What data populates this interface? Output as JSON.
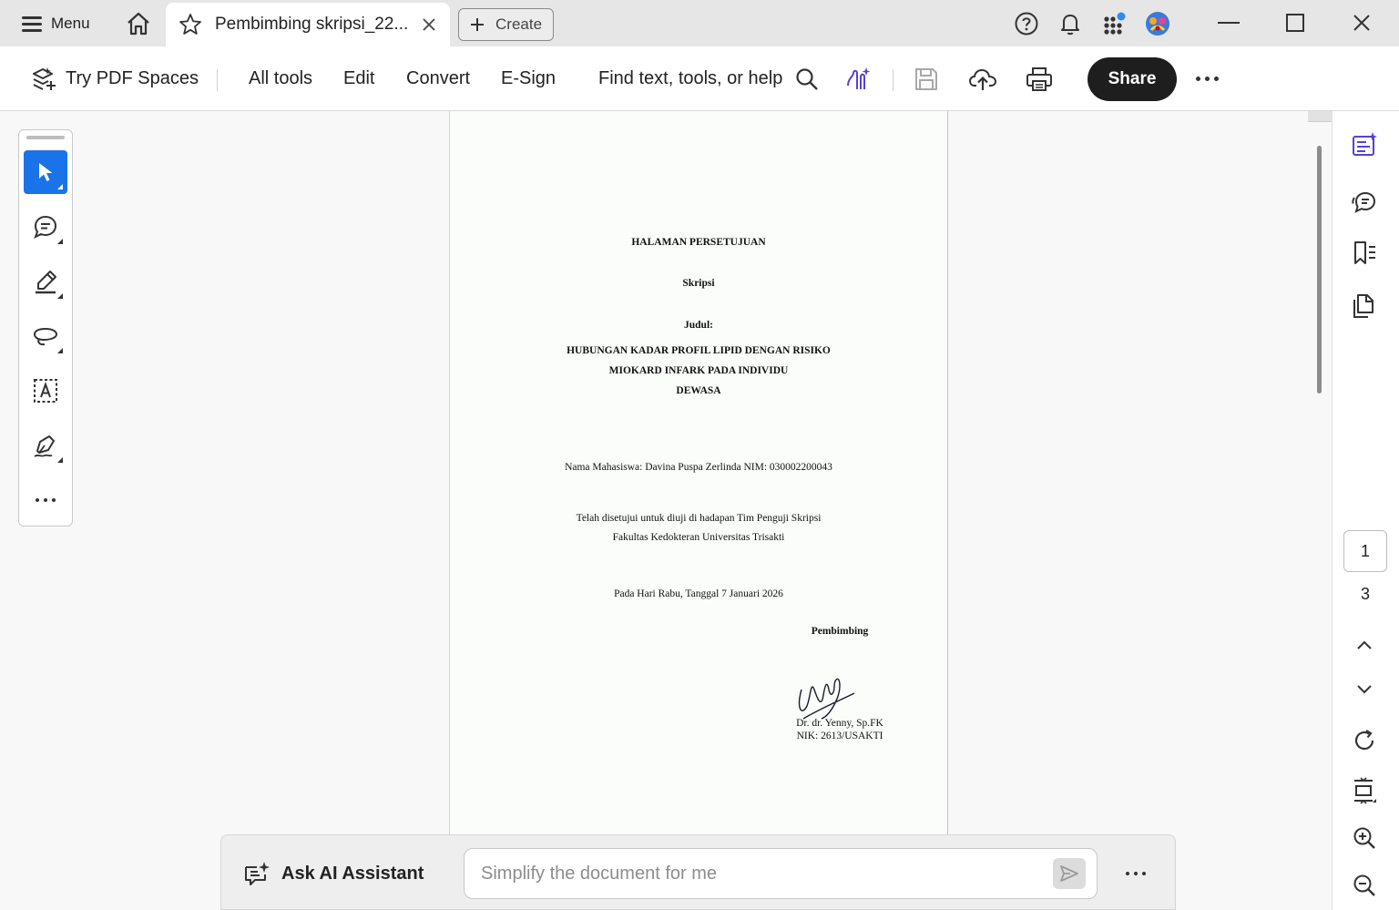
{
  "titlebar": {
    "menu_label": "Menu",
    "tab_title": "Pembimbing skripsi_22...",
    "create_label": "Create"
  },
  "toolbar": {
    "try_spaces": "Try PDF Spaces",
    "all_tools": "All tools",
    "edit": "Edit",
    "convert": "Convert",
    "esign": "E-Sign",
    "search_label": "Find text, tools, or help",
    "share": "Share"
  },
  "document": {
    "lines": [
      "HALAMAN PERSETUJUAN",
      "Skripsi",
      "Judul:",
      "HUBUNGAN KADAR PROFIL LIPID DENGAN RISIKO",
      "MIOKARD  INFARK PADA INDIVIDU",
      "DEWASA",
      "Nama Mahasiswa: Davina Puspa Zerlinda NIM: 030002200043",
      "Telah disetujui untuk diuji di hadapan Tim Penguji Skripsi",
      "Fakultas Kedokteran Universitas Trisakti",
      "Pada Hari Rabu, Tanggal 7 Januari 2026",
      "Pembimbing",
      "Dr. dr. Yenny, Sp.FK",
      "NIK: 2613/USAKTI"
    ]
  },
  "pagination": {
    "current": "1",
    "total": "3"
  },
  "ai": {
    "label": "Ask AI Assistant",
    "placeholder": "Simplify the document for me"
  },
  "colors": {
    "accent": "#1a73e8",
    "ai_purple": "#5b3fd6",
    "share_bg": "#1e1e1e"
  }
}
